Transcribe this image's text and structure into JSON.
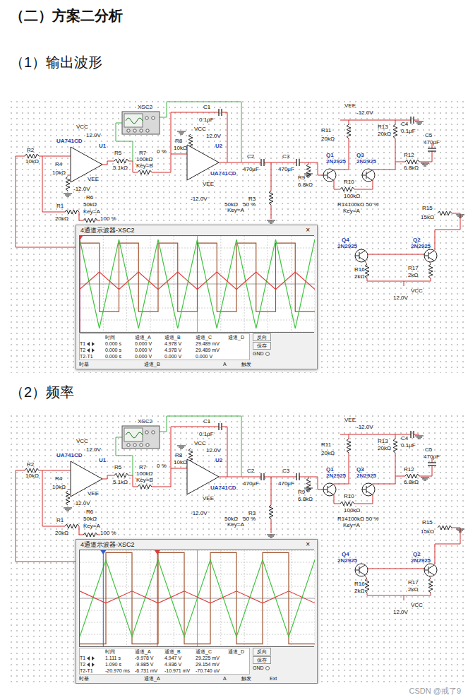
{
  "page": {
    "heading": "（二）方案二分析",
    "watermark": "CSDN @戒了9"
  },
  "sections": [
    {
      "title": "（1）输出波形",
      "figure": {
        "labels": [
          {
            "text": "VCC",
            "kind": "value"
          },
          {
            "text": "12.0V",
            "kind": "value"
          },
          {
            "text": "UA741CD",
            "kind": "part"
          },
          {
            "text": "U1",
            "kind": "part"
          },
          {
            "text": "VEE",
            "kind": "value"
          },
          {
            "text": "-12.0V",
            "kind": "value"
          },
          {
            "text": "R2",
            "kind": "value"
          },
          {
            "text": "10kΩ",
            "kind": "value"
          },
          {
            "text": "R4",
            "kind": "value"
          },
          {
            "text": "10kΩ",
            "kind": "value"
          },
          {
            "text": "R1",
            "kind": "value"
          },
          {
            "text": "20kΩ",
            "kind": "value"
          },
          {
            "text": "R6",
            "kind": "value"
          },
          {
            "text": "50kΩ",
            "kind": "value"
          },
          {
            "text": "Key=A",
            "kind": "value"
          },
          {
            "text": "100 %",
            "kind": "value"
          },
          {
            "text": "R5",
            "kind": "value"
          },
          {
            "text": "5.1kΩ",
            "kind": "value"
          },
          {
            "text": "XSC2",
            "kind": "value"
          },
          {
            "text": "R7",
            "kind": "value"
          },
          {
            "text": "100kΩ",
            "kind": "value"
          },
          {
            "text": "Key=B",
            "kind": "value"
          },
          {
            "text": "0 %",
            "kind": "value"
          },
          {
            "text": "C1",
            "kind": "value"
          },
          {
            "text": "0.1μF",
            "kind": "value"
          },
          {
            "text": "R8",
            "kind": "value"
          },
          {
            "text": "10kΩ",
            "kind": "value"
          },
          {
            "text": "VCC",
            "kind": "value"
          },
          {
            "text": "12.0V",
            "kind": "value"
          },
          {
            "text": "U2",
            "kind": "part"
          },
          {
            "text": "UA741CD",
            "kind": "part"
          },
          {
            "text": "VEE",
            "kind": "value"
          },
          {
            "text": "-12.0V",
            "kind": "value"
          },
          {
            "text": "C2",
            "kind": "value"
          },
          {
            "text": "470μF",
            "kind": "value"
          },
          {
            "text": "C3",
            "kind": "value"
          },
          {
            "text": "470μF",
            "kind": "value"
          },
          {
            "text": "R3",
            "kind": "value"
          },
          {
            "text": "50kΩ",
            "kind": "value"
          },
          {
            "text": "50 %",
            "kind": "value"
          },
          {
            "text": "Key=A",
            "kind": "value"
          },
          {
            "text": "R9",
            "kind": "value"
          },
          {
            "text": "6.8kΩ",
            "kind": "value"
          },
          {
            "text": "VEE",
            "kind": "value"
          },
          {
            "text": "-12.0V",
            "kind": "value"
          },
          {
            "text": "R11",
            "kind": "value"
          },
          {
            "text": "20kΩ",
            "kind": "value"
          },
          {
            "text": "R13",
            "kind": "value"
          },
          {
            "text": "20kΩ",
            "kind": "value"
          },
          {
            "text": "C4",
            "kind": "value"
          },
          {
            "text": "0.1μF",
            "kind": "value"
          },
          {
            "text": "Q1",
            "kind": "part"
          },
          {
            "text": "2N2925",
            "kind": "part"
          },
          {
            "text": "Q3",
            "kind": "part"
          },
          {
            "text": "2N2925",
            "kind": "part"
          },
          {
            "text": "R12",
            "kind": "value"
          },
          {
            "text": "6.8kΩ",
            "kind": "value"
          },
          {
            "text": "R10",
            "kind": "value"
          },
          {
            "text": "100kΩ",
            "kind": "value"
          },
          {
            "text": "R14100kΩ 50 %",
            "kind": "value"
          },
          {
            "text": "Key=A",
            "kind": "value"
          },
          {
            "text": "Q4",
            "kind": "part"
          },
          {
            "text": "2N2925",
            "kind": "part"
          },
          {
            "text": "R16",
            "kind": "value"
          },
          {
            "text": "2kΩ",
            "kind": "value"
          },
          {
            "text": "12.0V",
            "kind": "value"
          },
          {
            "text": "VCC",
            "kind": "value"
          },
          {
            "text": "C5",
            "kind": "value"
          },
          {
            "text": "470μF",
            "kind": "value"
          },
          {
            "text": "R15",
            "kind": "value"
          },
          {
            "text": "15kΩ",
            "kind": "value"
          },
          {
            "text": "Q2",
            "kind": "part"
          },
          {
            "text": "2N2925",
            "kind": "part"
          },
          {
            "text": "R17",
            "kind": "value"
          },
          {
            "text": "2kΩ",
            "kind": "value"
          }
        ],
        "scope": {
          "title": "4通道示波器-XSC2",
          "close": "×",
          "traces": [
            {
              "channel": "A",
              "kind": "square",
              "color": "#a0522d",
              "values_div": [
                3.4,
                -2.3,
                3.4,
                -2.3,
                3.4,
                -2.3,
                3.4,
                -2.3,
                3.4,
                -2.3,
                3.4,
                -2.3
              ]
            },
            {
              "channel": "B",
              "kind": "triangle",
              "color": "#3cc43c",
              "values_div": [
                3.7,
                -3.7,
                3.7,
                -3.7,
                3.7,
                -3.7,
                3.7,
                -3.7,
                3.7,
                -3.7,
                3.7,
                -3.7,
                3.7
              ]
            },
            {
              "channel": "C",
              "kind": "triangle",
              "color": "#e03a3a",
              "values_div": [
                -0.45,
                1.0,
                -0.45,
                1.0,
                -0.45,
                1.0,
                -0.45,
                1.0,
                -0.45,
                1.0,
                -0.45,
                1.0,
                -0.45
              ]
            }
          ],
          "cursors": [
            {
              "color": "#2f5fd0",
              "position": 0
            },
            {
              "color": "#e03a3a",
              "position": 0
            }
          ],
          "readout": {
            "columns": [
              "时间",
              "通道_A",
              "通道_B",
              "通道_C",
              "通道_D"
            ],
            "rows": [
              {
                "label": "T1",
                "cells": [
                  "0.000 s",
                  "0.000 V",
                  "4.978 V",
                  "29.489 mV"
                ]
              },
              {
                "label": "T2",
                "cells": [
                  "0.000 s",
                  "0.000 V",
                  "4.978 V",
                  "29.489 mV"
                ]
              },
              {
                "label": "T2-T1",
                "cells": [
                  "0.000 s",
                  "0.000 V",
                  "0.000 V",
                  "0.000 V"
                ]
              }
            ]
          },
          "buttons": [
            "反向",
            "保存"
          ],
          "ground": {
            "label": "GND",
            "selected": false
          },
          "controls": [
            "时基",
            "通道_B",
            "A",
            "触发"
          ]
        }
      }
    },
    {
      "title": "（2）频率",
      "figure": {
        "labels": [
          {
            "text": "VCC",
            "kind": "value"
          },
          {
            "text": "12.0V",
            "kind": "value"
          },
          {
            "text": "UA741CD",
            "kind": "part"
          },
          {
            "text": "U1",
            "kind": "part"
          },
          {
            "text": "VEE",
            "kind": "value"
          },
          {
            "text": "-12.0V",
            "kind": "value"
          },
          {
            "text": "R2",
            "kind": "value"
          },
          {
            "text": "10kΩ",
            "kind": "value"
          },
          {
            "text": "R4",
            "kind": "value"
          },
          {
            "text": "10kΩ",
            "kind": "value"
          },
          {
            "text": "R1",
            "kind": "value"
          },
          {
            "text": "20kΩ",
            "kind": "value"
          },
          {
            "text": "R6",
            "kind": "value"
          },
          {
            "text": "50kΩ",
            "kind": "value"
          },
          {
            "text": "Key=A",
            "kind": "value"
          },
          {
            "text": "100 %",
            "kind": "value"
          },
          {
            "text": "R5",
            "kind": "value"
          },
          {
            "text": "5.1kΩ",
            "kind": "value"
          },
          {
            "text": "XSC2",
            "kind": "value"
          },
          {
            "text": "R7",
            "kind": "value"
          },
          {
            "text": "100kΩ",
            "kind": "value"
          },
          {
            "text": "Key=B",
            "kind": "value"
          },
          {
            "text": "0 %",
            "kind": "value"
          },
          {
            "text": "C1",
            "kind": "value"
          },
          {
            "text": "0.1μF",
            "kind": "value"
          },
          {
            "text": "R8",
            "kind": "value"
          },
          {
            "text": "10kΩ",
            "kind": "value"
          },
          {
            "text": "VCC",
            "kind": "value"
          },
          {
            "text": "12.0V",
            "kind": "value"
          },
          {
            "text": "U2",
            "kind": "part"
          },
          {
            "text": "UA741CD",
            "kind": "part"
          },
          {
            "text": "VEE",
            "kind": "value"
          },
          {
            "text": "-12.0V",
            "kind": "value"
          },
          {
            "text": "C2",
            "kind": "value"
          },
          {
            "text": "470μF",
            "kind": "value"
          },
          {
            "text": "C3",
            "kind": "value"
          },
          {
            "text": "470μF",
            "kind": "value"
          },
          {
            "text": "R3",
            "kind": "value"
          },
          {
            "text": "50kΩ",
            "kind": "value"
          },
          {
            "text": "50 %",
            "kind": "value"
          },
          {
            "text": "Key=A",
            "kind": "value"
          },
          {
            "text": "R9",
            "kind": "value"
          },
          {
            "text": "6.8kΩ",
            "kind": "value"
          },
          {
            "text": "VEE",
            "kind": "value"
          },
          {
            "text": "-12.0V",
            "kind": "value"
          },
          {
            "text": "R11",
            "kind": "value"
          },
          {
            "text": "20kΩ",
            "kind": "value"
          },
          {
            "text": "R13",
            "kind": "value"
          },
          {
            "text": "20kΩ",
            "kind": "value"
          },
          {
            "text": "C4",
            "kind": "value"
          },
          {
            "text": "0.1μF",
            "kind": "value"
          },
          {
            "text": "Q1",
            "kind": "part"
          },
          {
            "text": "2N2925",
            "kind": "part"
          },
          {
            "text": "Q3",
            "kind": "part"
          },
          {
            "text": "2N2925",
            "kind": "part"
          },
          {
            "text": "R12",
            "kind": "value"
          },
          {
            "text": "6.8kΩ",
            "kind": "value"
          },
          {
            "text": "R10",
            "kind": "value"
          },
          {
            "text": "100kΩ",
            "kind": "value"
          },
          {
            "text": "R14100kΩ 50 %",
            "kind": "value"
          },
          {
            "text": "Key=A",
            "kind": "value"
          },
          {
            "text": "Q4",
            "kind": "part"
          },
          {
            "text": "2N2925",
            "kind": "part"
          },
          {
            "text": "R16",
            "kind": "value"
          },
          {
            "text": "2kΩ",
            "kind": "value"
          },
          {
            "text": "12.0V",
            "kind": "value"
          },
          {
            "text": "VCC",
            "kind": "value"
          },
          {
            "text": "C5",
            "kind": "value"
          },
          {
            "text": "470μF",
            "kind": "value"
          },
          {
            "text": "R15",
            "kind": "value"
          },
          {
            "text": "15kΩ",
            "kind": "value"
          },
          {
            "text": "Q2",
            "kind": "part"
          },
          {
            "text": "2N2925",
            "kind": "part"
          },
          {
            "text": "R17",
            "kind": "value"
          },
          {
            "text": "2kΩ",
            "kind": "value"
          }
        ],
        "scope": {
          "title": "4通道示波器-XSC2",
          "close": "×",
          "traces": [
            {
              "channel": "A",
              "kind": "square",
              "color": "#a0522d",
              "values_div": [
                -3.8,
                3.8,
                -3.8,
                3.8,
                -3.8,
                3.8,
                -3.8,
                3.8,
                -3.8
              ]
            },
            {
              "channel": "B",
              "kind": "triangle",
              "color": "#3cc43c",
              "values_div": [
                -3.2,
                3.2,
                -3.2,
                3.2,
                -3.2,
                3.2,
                -3.2,
                3.2,
                -3.2,
                3.2
              ]
            },
            {
              "channel": "C",
              "kind": "triangle",
              "color": "#e03a3a",
              "values_div": [
                0.6,
                -0.4,
                0.6,
                -0.4,
                0.6,
                -0.4,
                0.6,
                -0.4,
                0.6,
                -0.4
              ]
            }
          ],
          "cursors": [
            {
              "color": "#2f5fd0",
              "position": 0.1
            },
            {
              "color": "#e03a3a",
              "position": 0.33
            }
          ],
          "readout": {
            "columns": [
              "时间",
              "通道_A",
              "通道_B",
              "通道_C",
              "通道_D"
            ],
            "rows": [
              {
                "label": "T1",
                "cells": [
                  "1.111 s",
                  "-9.978 V",
                  "4.947 V",
                  "29.225 mV"
                ]
              },
              {
                "label": "T2",
                "cells": [
                  "1.090 s",
                  "-9.985 V",
                  "4.936 V",
                  "29.154 mV"
                ]
              },
              {
                "label": "T2-T1",
                "cells": [
                  "-20.970 ms",
                  "-6.731 mV",
                  "-10.971 mV",
                  "-70.740 uV"
                ]
              }
            ]
          },
          "buttons": [
            "反向",
            "保存"
          ],
          "ground": {
            "label": "GND",
            "selected": false
          },
          "controls": [
            "时基",
            "通道_A",
            "A",
            "触发",
            "Ext"
          ]
        }
      }
    }
  ]
}
